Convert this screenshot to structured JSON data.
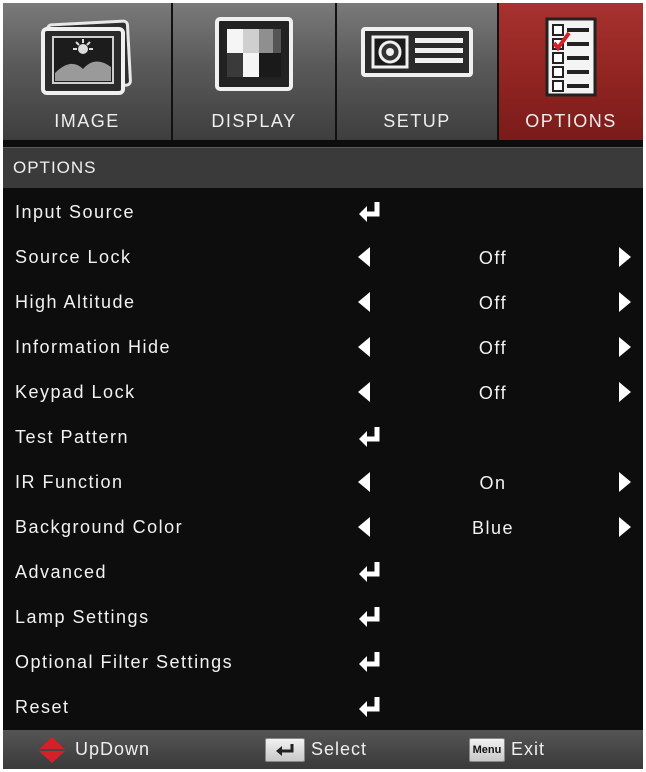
{
  "tabs": [
    {
      "label": "IMAGE",
      "icon": "image-icon",
      "active": false
    },
    {
      "label": "DISPLAY",
      "icon": "display-icon",
      "active": false
    },
    {
      "label": "SETUP",
      "icon": "setup-projector-icon",
      "active": false
    },
    {
      "label": "OPTIONS",
      "icon": "options-checklist-icon",
      "active": true
    }
  ],
  "header": {
    "title": "OPTIONS"
  },
  "rows": [
    {
      "label": "Input Source",
      "type": "enter"
    },
    {
      "label": "Source Lock",
      "type": "select",
      "value": "Off"
    },
    {
      "label": "High Altitude",
      "type": "select",
      "value": "Off"
    },
    {
      "label": "Information Hide",
      "type": "select",
      "value": "Off"
    },
    {
      "label": "Keypad Lock",
      "type": "select",
      "value": "Off"
    },
    {
      "label": "Test Pattern",
      "type": "enter"
    },
    {
      "label": "IR Function",
      "type": "select",
      "value": "On"
    },
    {
      "label": "Background Color",
      "type": "select",
      "value": "Blue"
    },
    {
      "label": "Advanced",
      "type": "enter"
    },
    {
      "label": "Lamp Settings",
      "type": "enter"
    },
    {
      "label": "Optional Filter Settings",
      "type": "enter"
    },
    {
      "label": "Reset",
      "type": "enter"
    }
  ],
  "footer": {
    "updown": "UpDown",
    "select": "Select",
    "menu_key": "Menu",
    "exit": "Exit"
  },
  "colors": {
    "active_tab": "#8e2320",
    "accent_updown": "#d42027"
  }
}
